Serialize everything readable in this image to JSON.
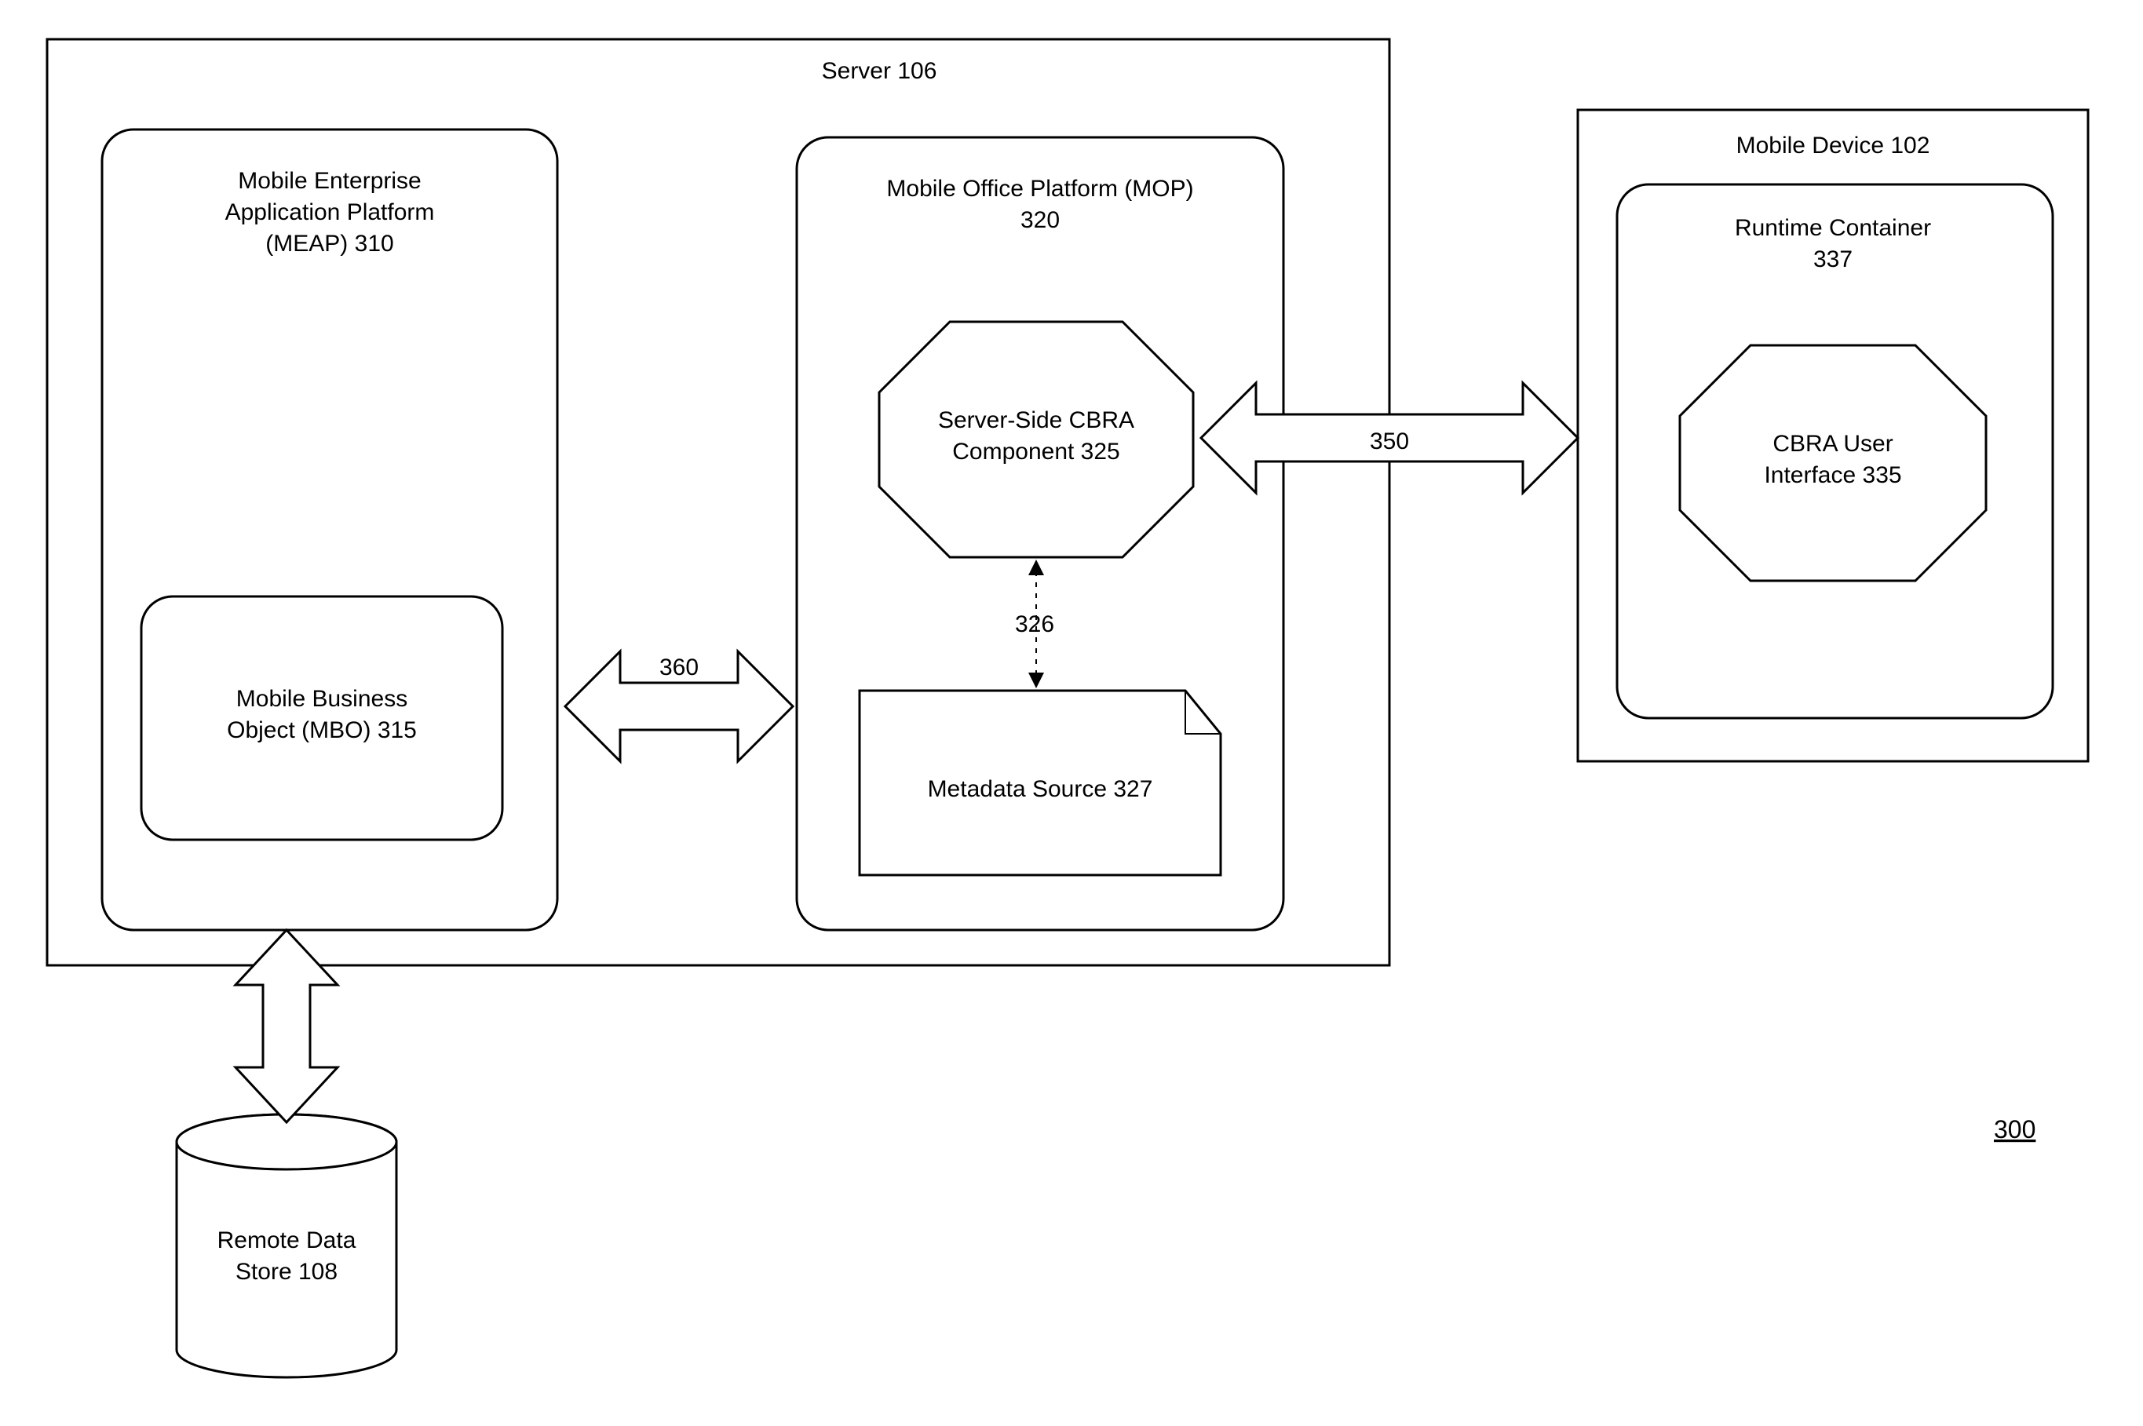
{
  "server_title": "Server 106",
  "mobile_device_title": "Mobile Device 102",
  "meap": {
    "l1": "Mobile Enterprise",
    "l2": "Application Platform",
    "l3": "(MEAP) 310"
  },
  "mbo": {
    "l1": "Mobile Business",
    "l2": "Object (MBO) 315"
  },
  "mop": {
    "l1": "Mobile Office Platform (MOP)",
    "l2": "320"
  },
  "cbra_server": {
    "l1": "Server-Side CBRA",
    "l2": "Component 325"
  },
  "metadata_source": "Metadata Source 327",
  "runtime_container": {
    "l1": "Runtime Container",
    "l2": "337"
  },
  "cbra_user": {
    "l1": "CBRA User",
    "l2": "Interface 335"
  },
  "remote_store": {
    "l1": "Remote Data",
    "l2": "Store 108"
  },
  "arrow_326": "326",
  "arrow_350": "350",
  "arrow_360": "360",
  "fig_no": "300"
}
